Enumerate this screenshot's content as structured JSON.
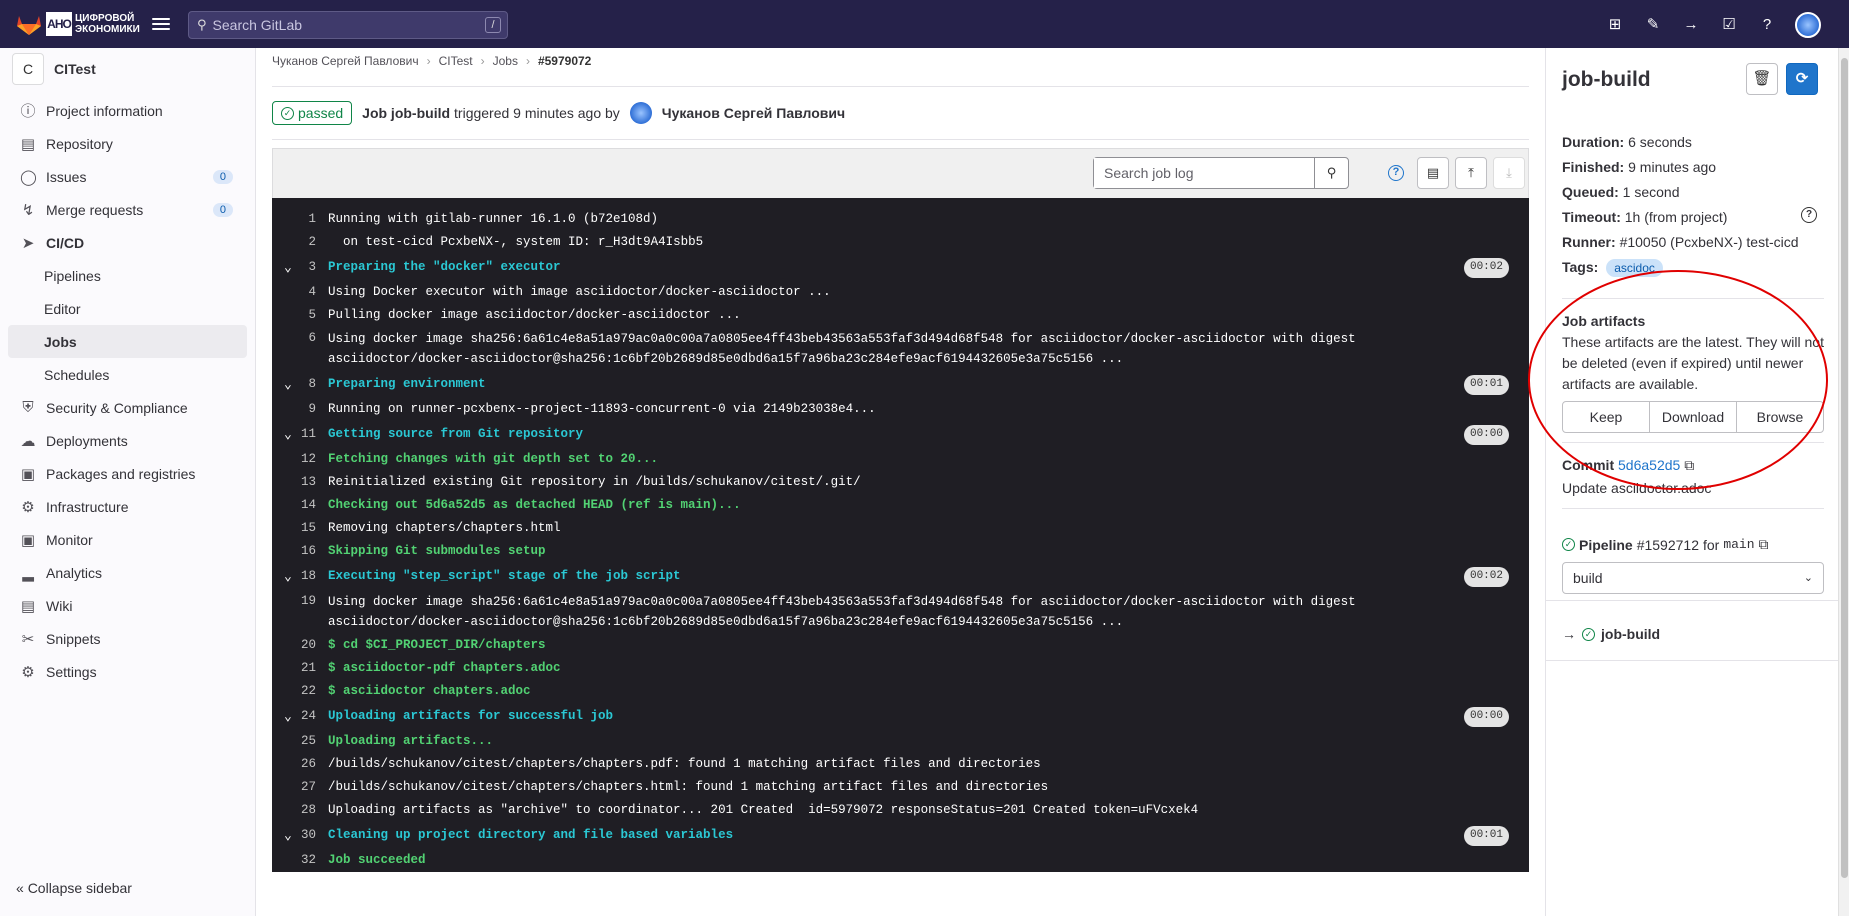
{
  "topbar": {
    "logo_line1": "ЦИФРОВОЙ",
    "logo_line2": "ЭКОНОМИКИ",
    "logo_box": "АНО",
    "search_placeholder": "Search GitLab",
    "search_shortcut": "/",
    "icons": [
      "plus-square-icon",
      "issues-icon",
      "merge-request-icon",
      "todo-icon",
      "help-icon",
      "avatar"
    ]
  },
  "sidebar": {
    "project_initial": "C",
    "project_name": "CITest",
    "items": [
      {
        "label": "Project information",
        "icon": "info-icon"
      },
      {
        "label": "Repository",
        "icon": "doc-icon"
      },
      {
        "label": "Issues",
        "icon": "issues-icon",
        "count": "0"
      },
      {
        "label": "Merge requests",
        "icon": "merge-request-icon",
        "count": "0"
      },
      {
        "label": "CI/CD",
        "icon": "rocket-icon"
      },
      {
        "label": "Pipelines"
      },
      {
        "label": "Editor"
      },
      {
        "label": "Jobs"
      },
      {
        "label": "Schedules"
      },
      {
        "label": "Security & Compliance",
        "icon": "shield-icon"
      },
      {
        "label": "Deployments",
        "icon": "deployments-icon"
      },
      {
        "label": "Packages and registries",
        "icon": "package-icon"
      },
      {
        "label": "Infrastructure",
        "icon": "cloud-gear-icon"
      },
      {
        "label": "Monitor",
        "icon": "monitor-icon"
      },
      {
        "label": "Analytics",
        "icon": "chart-icon"
      },
      {
        "label": "Wiki",
        "icon": "book-icon"
      },
      {
        "label": "Snippets",
        "icon": "scissors-icon"
      },
      {
        "label": "Settings",
        "icon": "gear-icon"
      }
    ],
    "collapse_label": "Collapse sidebar"
  },
  "breadcrumb": [
    "Чуканов Сергей Павлович",
    "CITest",
    "Jobs",
    "#5979072"
  ],
  "header": {
    "status": "passed",
    "job_title": "Job job-build",
    "triggered": "triggered 9 minutes ago by",
    "user": "Чуканов Сергей Павлович"
  },
  "log_toolbar": {
    "search_placeholder": "Search job log"
  },
  "log": [
    {
      "n": "1",
      "t": "Running with gitlab-runner 16.1.0 (b72e108d)",
      "c": ""
    },
    {
      "n": "2",
      "t": "  on test-cicd PcxbeNX-, system ID: r_H3dt9A4Isbb5",
      "c": ""
    },
    {
      "n": "3",
      "t": "Preparing the \"docker\" executor",
      "c": "cyan",
      "section": true,
      "dur": "00:02"
    },
    {
      "n": "4",
      "t": "Using Docker executor with image asciidoctor/docker-asciidoctor ...",
      "c": ""
    },
    {
      "n": "5",
      "t": "Pulling docker image asciidoctor/docker-asciidoctor ...",
      "c": ""
    },
    {
      "n": "6",
      "t": "Using docker image sha256:6a61c4e8a51a979ac0a0c00a7a0805ee4ff43beb43563a553faf3d494d68f548 for asciidoctor/docker-asciidoctor with digest asciidoctor/docker-asciidoctor@sha256:1c6bf20b2689d85e0dbd6a15f7a96ba23c284efe9acf6194432605e3a75c5156 ...",
      "c": "",
      "wrap": true
    },
    {
      "n": "8",
      "t": "Preparing environment",
      "c": "cyan",
      "section": true,
      "dur": "00:01"
    },
    {
      "n": "9",
      "t": "Running on runner-pcxbenx--project-11893-concurrent-0 via 2149b23038e4...",
      "c": ""
    },
    {
      "n": "11",
      "t": "Getting source from Git repository",
      "c": "cyan",
      "section": true,
      "dur": "00:00"
    },
    {
      "n": "12",
      "t": "Fetching changes with git depth set to 20...",
      "c": "green"
    },
    {
      "n": "13",
      "t": "Reinitialized existing Git repository in /builds/schukanov/citest/.git/",
      "c": ""
    },
    {
      "n": "14",
      "t": "Checking out 5d6a52d5 as detached HEAD (ref is main)...",
      "c": "green"
    },
    {
      "n": "15",
      "t": "Removing chapters/chapters.html",
      "c": ""
    },
    {
      "n": "16",
      "t": "Skipping Git submodules setup",
      "c": "green"
    },
    {
      "n": "18",
      "t": "Executing \"step_script\" stage of the job script",
      "c": "cyan",
      "section": true,
      "dur": "00:02"
    },
    {
      "n": "19",
      "t": "Using docker image sha256:6a61c4e8a51a979ac0a0c00a7a0805ee4ff43beb43563a553faf3d494d68f548 for asciidoctor/docker-asciidoctor with digest asciidoctor/docker-asciidoctor@sha256:1c6bf20b2689d85e0dbd6a15f7a96ba23c284efe9acf6194432605e3a75c5156 ...",
      "c": "",
      "wrap": true
    },
    {
      "n": "20",
      "t": "$ cd $CI_PROJECT_DIR/chapters",
      "c": "green"
    },
    {
      "n": "21",
      "t": "$ asciidoctor-pdf chapters.adoc",
      "c": "green"
    },
    {
      "n": "22",
      "t": "$ asciidoctor chapters.adoc",
      "c": "green"
    },
    {
      "n": "24",
      "t": "Uploading artifacts for successful job",
      "c": "cyan",
      "section": true,
      "dur": "00:00"
    },
    {
      "n": "25",
      "t": "Uploading artifacts...",
      "c": "green"
    },
    {
      "n": "26",
      "t": "/builds/schukanov/citest/chapters/chapters.pdf: found 1 matching artifact files and directories",
      "c": ""
    },
    {
      "n": "27",
      "t": "/builds/schukanov/citest/chapters/chapters.html: found 1 matching artifact files and directories",
      "c": ""
    },
    {
      "n": "28",
      "t": "Uploading artifacts as \"archive\" to coordinator... 201 Created  id=5979072 responseStatus=201 Created token=uFVcxek4",
      "c": ""
    },
    {
      "n": "30",
      "t": "Cleaning up project directory and file based variables",
      "c": "cyan",
      "section": true,
      "dur": "00:01"
    },
    {
      "n": "32",
      "t": "Job succeeded",
      "c": "green"
    }
  ],
  "panel": {
    "title": "job-build",
    "duration_label": "Duration:",
    "duration": "6 seconds",
    "finished_label": "Finished:",
    "finished": "9 minutes ago",
    "queued_label": "Queued:",
    "queued": "1 second",
    "timeout_label": "Timeout:",
    "timeout": "1h (from project)",
    "runner_label": "Runner:",
    "runner": "#10050 (PcxbeNX-) test-cicd",
    "tags_label": "Tags:",
    "tag": "ascidoc",
    "artifacts_title": "Job artifacts",
    "artifacts_desc": "These artifacts are the latest. They will not be deleted (even if expired) until newer artifacts are available.",
    "keep": "Keep",
    "download": "Download",
    "browse": "Browse",
    "commit_label": "Commit",
    "commit_sha": "5d6a52d5",
    "commit_msg": "Update asciidoctor.adoc",
    "pipeline_label": "Pipeline",
    "pipeline_id": "#1592712",
    "pipeline_for": "for",
    "pipeline_ref": "main",
    "stage": "build",
    "job_item": "job-build"
  }
}
